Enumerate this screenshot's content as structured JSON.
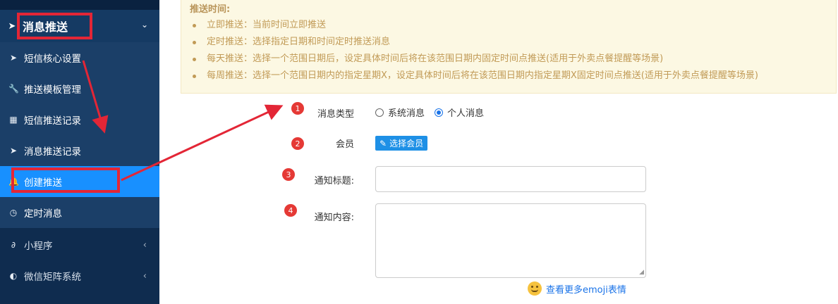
{
  "sidebar": {
    "group": {
      "label": "消息推送",
      "icon": "paper-plane-icon",
      "chevron": "chevron-down-icon"
    },
    "items": [
      {
        "label": "短信核心设置",
        "icon": "paper-plane-icon"
      },
      {
        "label": "推送模板管理",
        "icon": "wrench-icon"
      },
      {
        "label": "短信推送记录",
        "icon": "table-icon"
      },
      {
        "label": "消息推送记录",
        "icon": "paper-plane-icon"
      },
      {
        "label": "创建推送",
        "icon": "bell-icon",
        "active": true
      },
      {
        "label": "定时消息",
        "icon": "clock-icon"
      }
    ],
    "top_items": [
      {
        "label": "小程序",
        "icon": "link-icon"
      },
      {
        "label": "微信矩阵系统",
        "icon": "wechat-icon"
      }
    ]
  },
  "notice": {
    "title": "推送时间:",
    "items": [
      "立即推送：当前时间立即推送",
      "定时推送：选择指定日期和时间定时推送消息",
      "每天推送：选择一个范围日期后，设定具体时间后将在该范围日期内固定时间点推送(适用于外卖点餐提醒等场景)",
      "每周推送：选择一个范围日期内的指定星期X，设定具体时间后将在该范围日期内指定星期X固定时间点推送(适用于外卖点餐提醒等场景)"
    ]
  },
  "form": {
    "message_type_label": "消息类型",
    "options": [
      "系统消息",
      "个人消息"
    ],
    "selected_option": "个人消息",
    "member_label": "会员",
    "select_member_button": "选择会员",
    "title_label": "通知标题:",
    "title_value": "",
    "content_label": "通知内容:",
    "content_value": "",
    "emoji_link": "查看更多emoji表情"
  },
  "annotations": {
    "badges": [
      "1",
      "2",
      "3",
      "4"
    ],
    "highlight_color": "#e32636"
  },
  "colors": {
    "sidebar_bg": "#0f2c4f",
    "active": "#1890ff",
    "notice_bg": "#fcf8e3",
    "notice_text": "#c19a56",
    "badge": "#e53935"
  }
}
